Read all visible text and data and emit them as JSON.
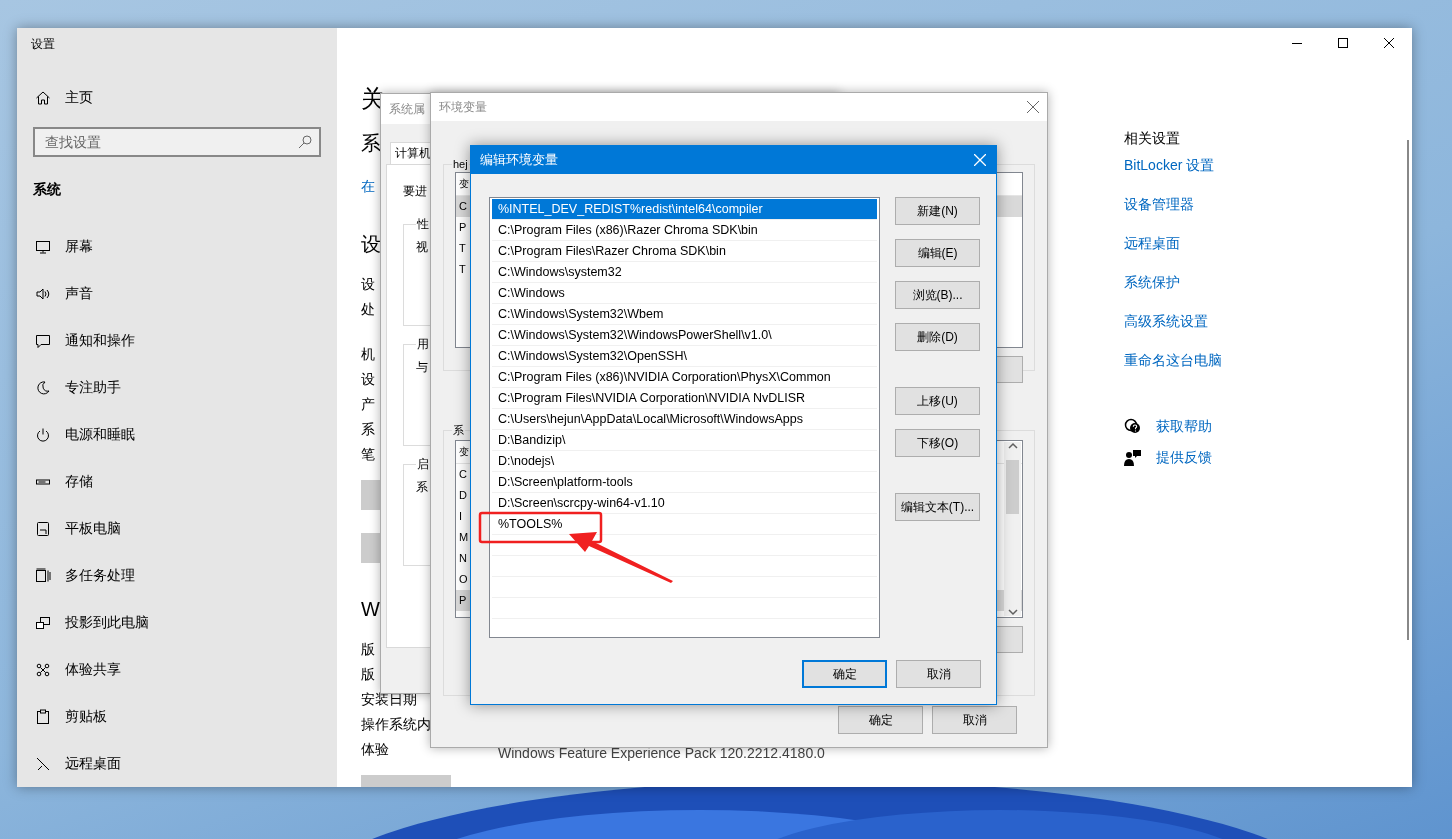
{
  "settings": {
    "title": "设置",
    "home": "主页",
    "search": {
      "placeholder": "查找设置"
    },
    "section": "系统",
    "nav": [
      {
        "label": "屏幕"
      },
      {
        "label": "声音"
      },
      {
        "label": "通知和操作"
      },
      {
        "label": "专注助手"
      },
      {
        "label": "电源和睡眠"
      },
      {
        "label": "存储"
      },
      {
        "label": "平板电脑"
      },
      {
        "label": "多任务处理"
      },
      {
        "label": "投影到此电脑"
      },
      {
        "label": "体验共享"
      },
      {
        "label": "剪贴板"
      },
      {
        "label": "远程桌面"
      }
    ],
    "about": {
      "title": "关",
      "subtitle": "系",
      "link": "在",
      "specs_heading": "设",
      "spec_groups": [
        [
          "设",
          "处"
        ],
        [
          "机",
          "设",
          "产",
          "系",
          "笔"
        ]
      ],
      "windows_heading": "W",
      "windows_rows": [
        {
          "label": "版"
        },
        {
          "label": "版"
        },
        {
          "label": "安装日期"
        },
        {
          "label": "操作系统内"
        },
        {
          "label": "体验",
          "value": "Windows Feature Experience Pack 120.2212.4180.0"
        }
      ]
    },
    "related": {
      "title": "相关设置",
      "links": [
        "BitLocker 设置",
        "设备管理器",
        "远程桌面",
        "系统保护",
        "高级系统设置",
        "重命名这台电脑"
      ]
    },
    "support": [
      "获取帮助",
      "提供反馈"
    ]
  },
  "system_properties": {
    "title": "系统属",
    "tab": "计算机",
    "intro": "要进",
    "groups": [
      {
        "legend": "性",
        "text": "视"
      },
      {
        "legend": "用",
        "text": "与"
      },
      {
        "legend": "启",
        "text": "系"
      }
    ]
  },
  "environment_variables": {
    "title": "环境变量",
    "user_group": "hej",
    "user_list": {
      "header": "变",
      "rows": [
        {
          "text": "C",
          "selected": true
        },
        {
          "text": "P",
          "selected": false
        },
        {
          "text": "T",
          "selected": false
        },
        {
          "text": "T",
          "selected": false
        }
      ]
    },
    "system_group": "系",
    "system_list": {
      "header": "变",
      "rows": [
        {
          "text": "C",
          "selected": false
        },
        {
          "text": "D",
          "selected": false
        },
        {
          "text": "I",
          "selected": false
        },
        {
          "text": "M",
          "selected": false
        },
        {
          "text": "N",
          "selected": false
        },
        {
          "text": "O",
          "selected": false
        },
        {
          "text": "P",
          "selected": true
        }
      ]
    },
    "buttons": [
      "确定",
      "取消"
    ]
  },
  "edit_dialog": {
    "title": "编辑环境变量",
    "entries": [
      {
        "text": "%INTEL_DEV_REDIST%redist\\intel64\\compiler",
        "selected": true
      },
      {
        "text": "C:\\Program Files (x86)\\Razer Chroma SDK\\bin",
        "selected": false
      },
      {
        "text": "C:\\Program Files\\Razer Chroma SDK\\bin",
        "selected": false
      },
      {
        "text": "C:\\Windows\\system32",
        "selected": false
      },
      {
        "text": "C:\\Windows",
        "selected": false
      },
      {
        "text": "C:\\Windows\\System32\\Wbem",
        "selected": false
      },
      {
        "text": "C:\\Windows\\System32\\WindowsPowerShell\\v1.0\\",
        "selected": false
      },
      {
        "text": "C:\\Windows\\System32\\OpenSSH\\",
        "selected": false
      },
      {
        "text": "C:\\Program Files (x86)\\NVIDIA Corporation\\PhysX\\Common",
        "selected": false
      },
      {
        "text": "C:\\Program Files\\NVIDIA Corporation\\NVIDIA NvDLISR",
        "selected": false
      },
      {
        "text": "C:\\Users\\hejun\\AppData\\Local\\Microsoft\\WindowsApps",
        "selected": false
      },
      {
        "text": "D:\\Bandizip\\",
        "selected": false
      },
      {
        "text": "D:\\nodejs\\",
        "selected": false
      },
      {
        "text": "D:\\Screen\\platform-tools",
        "selected": false
      },
      {
        "text": "D:\\Screen\\scrcpy-win64-v1.10",
        "selected": false
      },
      {
        "text": "%TOOLS%",
        "selected": false
      }
    ],
    "button_groups": [
      [
        "新建(N)",
        "编辑(E)",
        "浏览(B)...",
        "删除(D)"
      ],
      [
        "上移(U)",
        "下移(O)"
      ],
      [
        "编辑文本(T)..."
      ]
    ],
    "buttons": [
      {
        "label": "确定",
        "default": true
      },
      {
        "label": "取消",
        "default": false
      }
    ]
  }
}
